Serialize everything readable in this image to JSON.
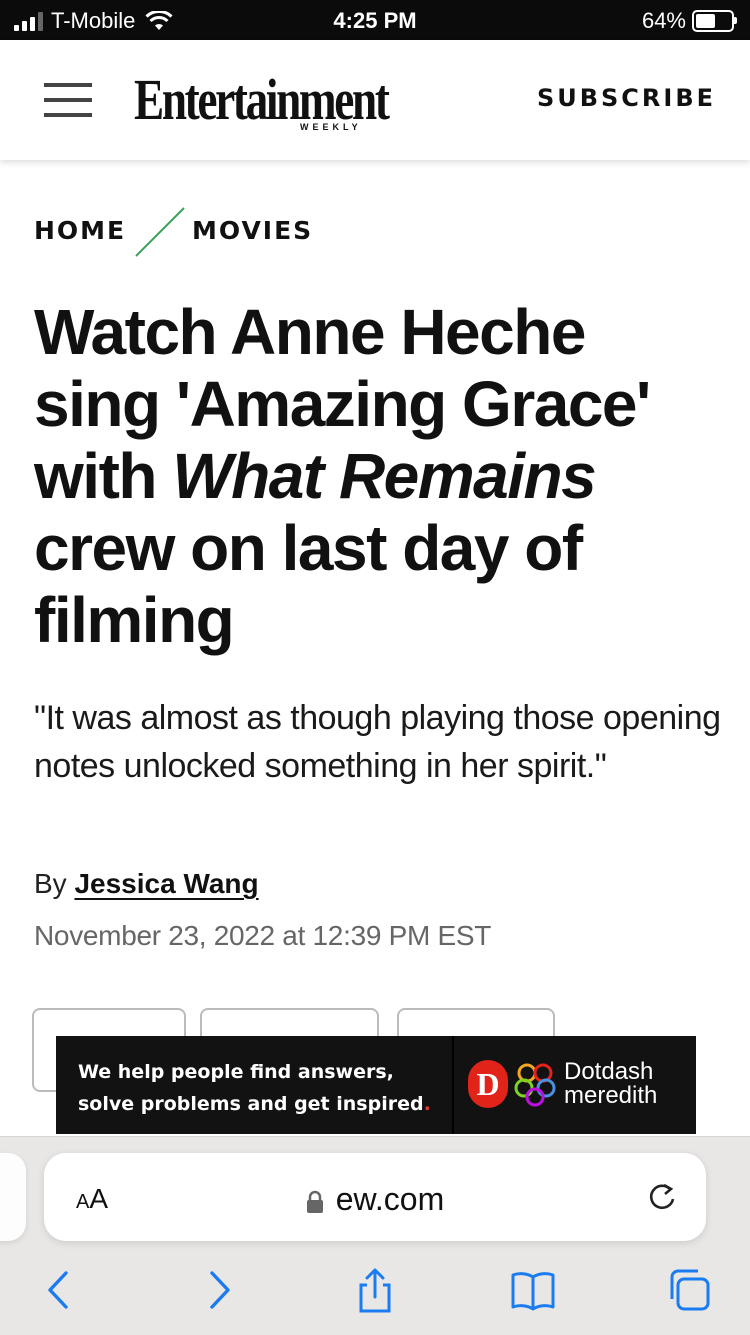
{
  "status_bar": {
    "carrier": "T-Mobile",
    "time": "4:25 PM",
    "battery_percent": "64%",
    "battery_level": 0.64,
    "signal_bars_active": 3,
    "signal_bars_total": 4
  },
  "header": {
    "logo": "Entertainment",
    "logo_sub": "WEEKLY",
    "subscribe_label": "SUBSCRIBE",
    "menu_icon": "hamburger-menu-icon"
  },
  "breadcrumb": {
    "items": [
      "HOME",
      "MOVIES"
    ],
    "separator_color": "#3aa05a"
  },
  "article": {
    "headline_part1": "Watch Anne Heche sing 'Amazing Grace' with ",
    "headline_italic": "What Remains",
    "headline_part2": " crew on last day of filming",
    "dek": "\"It was almost as though playing those opening notes unlocked something in her spirit.\"",
    "byline_prefix": "By",
    "author": "Jessica Wang",
    "date": "November 23, 2022 at 12:39 PM EST"
  },
  "ad": {
    "line1": "We help people find answers,",
    "line2": "solve problems and get inspired",
    "line2_end": ".",
    "brand_mark": "D",
    "brand_line1": "Dotdash",
    "brand_line2": "meredith",
    "accent_color": "#e2231a"
  },
  "browser": {
    "text_size_label_big": "A",
    "text_size_label_small": "A",
    "url": "ew.com",
    "icons": [
      "lock-icon",
      "reload-icon",
      "back-icon",
      "forward-icon",
      "share-icon",
      "bookmarks-icon",
      "tabs-icon"
    ],
    "accent_color": "#1a7cf0"
  }
}
